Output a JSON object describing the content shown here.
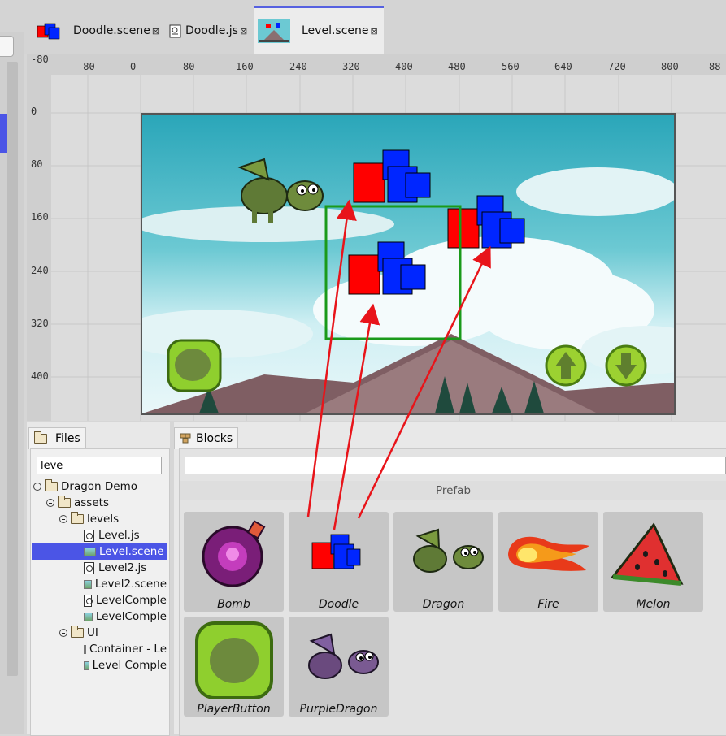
{
  "tabs": [
    {
      "label": "Doodle.scene",
      "close": "⊠",
      "icon": "doodle-thumb-icon"
    },
    {
      "label": "Doodle.js",
      "close": "⊠",
      "icon": "js-file-icon"
    },
    {
      "label": "Level.scene",
      "close": "⊠",
      "icon": "level-thumb-icon",
      "active": true
    }
  ],
  "ruler": {
    "top": [
      "-80",
      "0",
      "80",
      "160",
      "240",
      "320",
      "400",
      "480",
      "560",
      "640",
      "720",
      "800",
      "88"
    ],
    "corner": "-80",
    "left": [
      "0",
      "80",
      "160",
      "240",
      "320",
      "400"
    ]
  },
  "files": {
    "tab_label": "Files",
    "search_value": "leve",
    "tree": [
      {
        "label": "Dragon Demo",
        "kind": "folder",
        "level": 0
      },
      {
        "label": "assets",
        "kind": "folder",
        "level": 1
      },
      {
        "label": "levels",
        "kind": "folder",
        "level": 2
      },
      {
        "label": "Level.js",
        "kind": "js",
        "level": 3
      },
      {
        "label": "Level.scene",
        "kind": "scene",
        "level": 3,
        "selected": true
      },
      {
        "label": "Level2.js",
        "kind": "js",
        "level": 3
      },
      {
        "label": "Level2.scene",
        "kind": "scene",
        "level": 3
      },
      {
        "label": "LevelComple",
        "kind": "js",
        "level": 3
      },
      {
        "label": "LevelComple",
        "kind": "scene",
        "level": 3
      },
      {
        "label": "UI",
        "kind": "folder",
        "level": 2
      },
      {
        "label": "Container - Le",
        "kind": "image",
        "level": 3
      },
      {
        "label": "Level Comple",
        "kind": "image",
        "level": 3
      }
    ]
  },
  "blocks": {
    "tab_label": "Blocks",
    "search_value": "",
    "section_title": "Prefab",
    "prefabs": [
      "Bomb",
      "Doodle",
      "Dragon",
      "Fire",
      "Melon",
      "PlayerButton",
      "PurpleDragon"
    ]
  },
  "colors": {
    "accent": "#4b55e6",
    "arrow": "#e8141a",
    "selection_box": "#1a9a1a",
    "doodle_red": "#ff0000",
    "doodle_blue": "#0026ff"
  }
}
